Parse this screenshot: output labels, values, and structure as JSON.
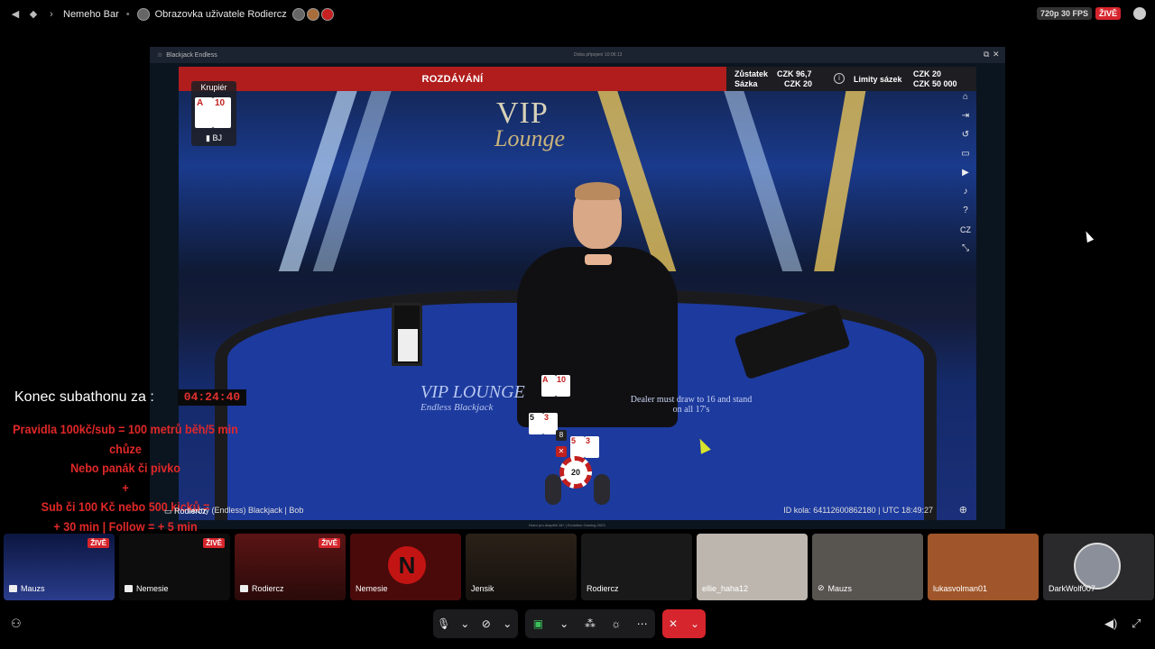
{
  "topbar": {
    "server_name": "Nemeho Bar",
    "screen_share_label": "Obrazovka uživatele Rodiercz",
    "quality": "720p 30 FPS",
    "live_badge": "ŽIVĚ"
  },
  "stream_window": {
    "title": "Blackjack Endless",
    "center_text": "Doba připojení 10:06:13",
    "game": {
      "status": "ROZDÁVÁNÍ",
      "balance_label": "Zůstatek",
      "balance_value": "CZK 96,7",
      "bet_label": "Sázka",
      "bet_value": "CZK 20",
      "limits_label": "Limity sázek",
      "limit_min": "CZK 20",
      "limit_max": "CZK 50 000",
      "dealer_label": "Krupiér",
      "dealer_cards": [
        "A",
        "10"
      ],
      "dealer_bj_label": "BJ",
      "logo_top": "VIP",
      "logo_bottom": "Lounge",
      "felt_logo": "VIP LOUNGE",
      "felt_sub": "Endless Blackjack",
      "table_rule": "Dealer must draw to 16 and stand on all 17's",
      "player_cards_a": [
        "5",
        "3"
      ],
      "player_cards_b": [
        "5",
        "3"
      ],
      "hand_count": "8",
      "chip_value": "20",
      "footer_left": "nečný (Endless) Blackjack | Bob",
      "footer_right": "ID kola: 6411260086218​0 | UTC 18:49:27",
      "side_icons": [
        "home-icon",
        "exit-icon",
        "history-icon",
        "chat-icon",
        "video-icon",
        "sound-icon",
        "help-icon",
        "language-cz",
        "fullscreen-icon"
      ],
      "language": "CZ",
      "help": "?"
    },
    "fine_print": "Hraní pro dospělé 18+ | Evolution Gaming 2023"
  },
  "overlay": {
    "countdown_label": "Konec subathonu za :",
    "countdown_value": "04:24:40",
    "rule_lines": [
      "Pravidla 100kč/sub = 100 metrů běh/5 min chůze",
      "Nebo panák či pivko",
      "+",
      "Sub či 100 Kč nebo 500 kicků =",
      "+ 30 min | Follow = + 5 min"
    ],
    "streamer_name": "Rodiercz"
  },
  "participants": [
    {
      "name": "Mauzs",
      "live": "ŽIVĚ"
    },
    {
      "name": "Nemesie",
      "live": "ŽIVĚ"
    },
    {
      "name": "Rodiercz",
      "live": "ŽIVĚ"
    },
    {
      "name": "Nemesie",
      "live": ""
    },
    {
      "name": "Jensik",
      "live": ""
    },
    {
      "name": "Rodiercz",
      "live": ""
    },
    {
      "name": "ellie_haha12",
      "live": ""
    },
    {
      "name": "Mauzs",
      "live": ""
    },
    {
      "name": "lukasvolman01",
      "live": ""
    },
    {
      "name": "DarkWolf007",
      "live": ""
    }
  ],
  "colors": {
    "live_red": "#d6252c",
    "status_red": "#b11d1d",
    "rules_red": "#e02828"
  }
}
